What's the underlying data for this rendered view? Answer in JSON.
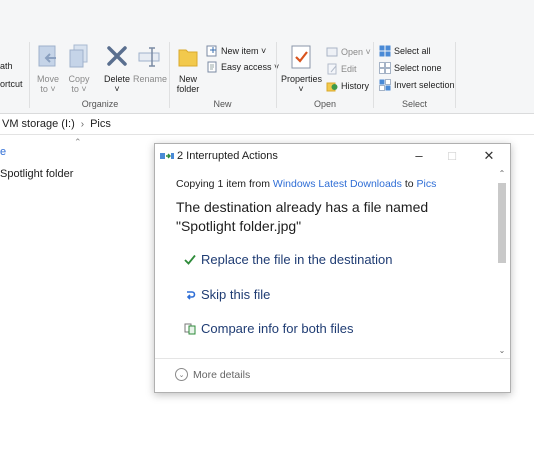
{
  "ribbon": {
    "partial_left_top": "ath",
    "partial_left_bottom": "ortcut",
    "move_to": {
      "line1": "Move",
      "line2": "to ˅"
    },
    "copy_to": {
      "line1": "Copy",
      "line2": "to ˅"
    },
    "delete": {
      "line1": "Delete",
      "line2": "˅"
    },
    "rename": "Rename",
    "new_folder": {
      "line1": "New",
      "line2": "folder"
    },
    "new_item": "New item ˅",
    "easy_access": "Easy access ˅",
    "properties": {
      "line1": "Properties",
      "line2": "˅"
    },
    "open": "Open ˅",
    "edit": "Edit",
    "history": "History",
    "select_all": "Select all",
    "select_none": "Select none",
    "invert_selection": "Invert selection",
    "groups": {
      "organize": "Organize",
      "new": "New",
      "open": "Open",
      "select": "Select"
    }
  },
  "address": {
    "drive": "VM storage (I:)",
    "folder": "Pics"
  },
  "file_list": {
    "column_partial": "e",
    "item": "Spotlight folder"
  },
  "dialog": {
    "title": "2 Interrupted Actions",
    "copy_prefix": "Copying",
    "count": "1",
    "copy_mid": "item from",
    "source": "Windows Latest Downloads",
    "to_word": "to",
    "dest": "Pics",
    "headline": "The destination already has a file named \"Spotlight folder.jpg\"",
    "options": [
      {
        "label": "Replace the file in the destination",
        "icon": "checkmark-icon"
      },
      {
        "label": "Skip this file",
        "icon": "skip-arrow-icon"
      },
      {
        "label": "Compare info for both files",
        "icon": "compare-files-icon"
      }
    ],
    "more_details": "More details"
  },
  "colors": {
    "link": "#2f6ed6",
    "option_text": "#1f3c73",
    "check": "#2e8b3a"
  }
}
